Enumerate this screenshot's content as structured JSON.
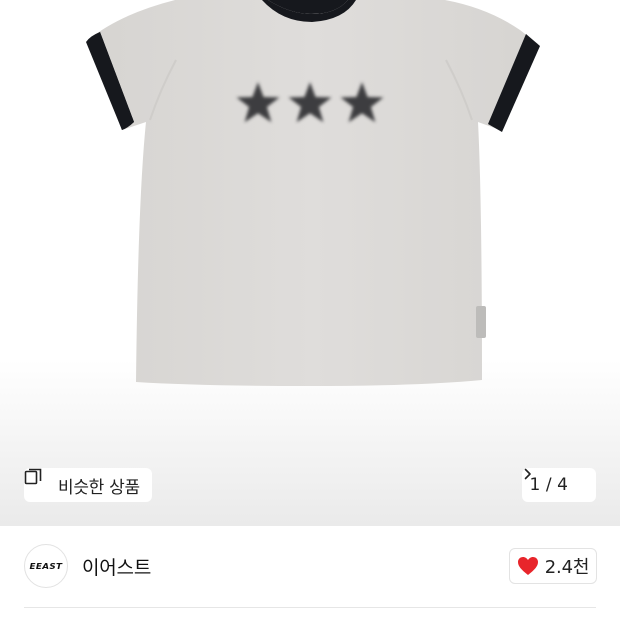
{
  "product_image": {
    "alt": "",
    "shirt_color": "#dcdad7",
    "trim_color": "#16181d",
    "stars": 3
  },
  "similar_products": {
    "icon": "similar-products-icon",
    "label": "비슷한 상품"
  },
  "pager": {
    "current": "1",
    "separator": "/",
    "total": "4",
    "icon": "chevron-right-icon"
  },
  "brand": {
    "logo_text": "EEAST",
    "name": "이어스트"
  },
  "like": {
    "icon": "heart-icon",
    "count": "2.4천",
    "color": "#e8252b"
  }
}
